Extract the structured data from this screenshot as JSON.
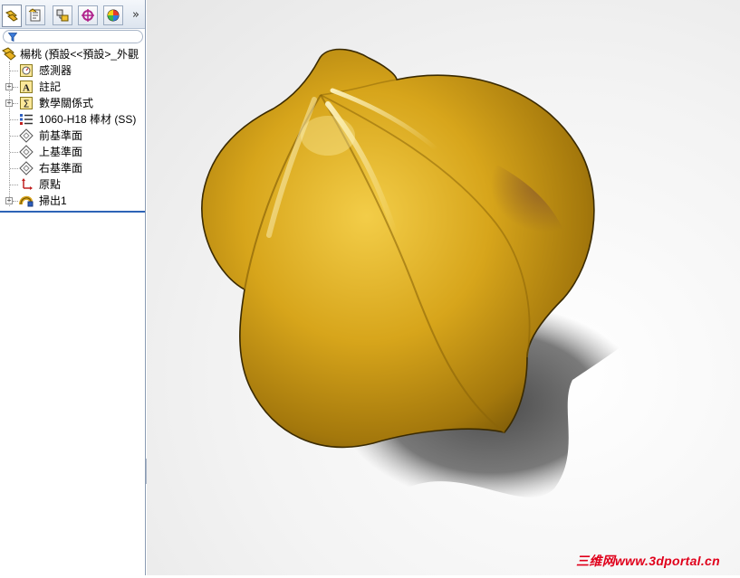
{
  "feature_manager": {
    "tabs": [
      {
        "name": "featuremanager-tab",
        "icon": "featuremanager-icon"
      },
      {
        "name": "propertymanager-tab",
        "icon": "propertymanager-icon"
      },
      {
        "name": "configurationmanager-tab",
        "icon": "configuration-icon"
      },
      {
        "name": "dimxpert-tab",
        "icon": "dimxpert-icon"
      },
      {
        "name": "display-manager-tab",
        "icon": "display-manager-icon"
      }
    ],
    "more_label": "»",
    "tree": {
      "root": "楊桃 (預設<<預設>_外觀",
      "items": [
        {
          "label": "感測器",
          "icon": "sensor-icon"
        },
        {
          "label": "註記",
          "icon": "annotations-icon"
        },
        {
          "label": "數學關係式",
          "icon": "equations-icon"
        },
        {
          "label": "1060-H18 棒材 (SS)",
          "icon": "material-icon"
        },
        {
          "label": "前基準面",
          "icon": "plane-icon"
        },
        {
          "label": "上基準面",
          "icon": "plane-icon"
        },
        {
          "label": "右基準面",
          "icon": "plane-icon"
        },
        {
          "label": "原點",
          "icon": "origin-icon"
        },
        {
          "label": "掃出1",
          "icon": "sweep-icon"
        }
      ]
    }
  },
  "viewport": {
    "model_color": "#d4a018",
    "watermark": "三维网www.3dportal.cn"
  }
}
